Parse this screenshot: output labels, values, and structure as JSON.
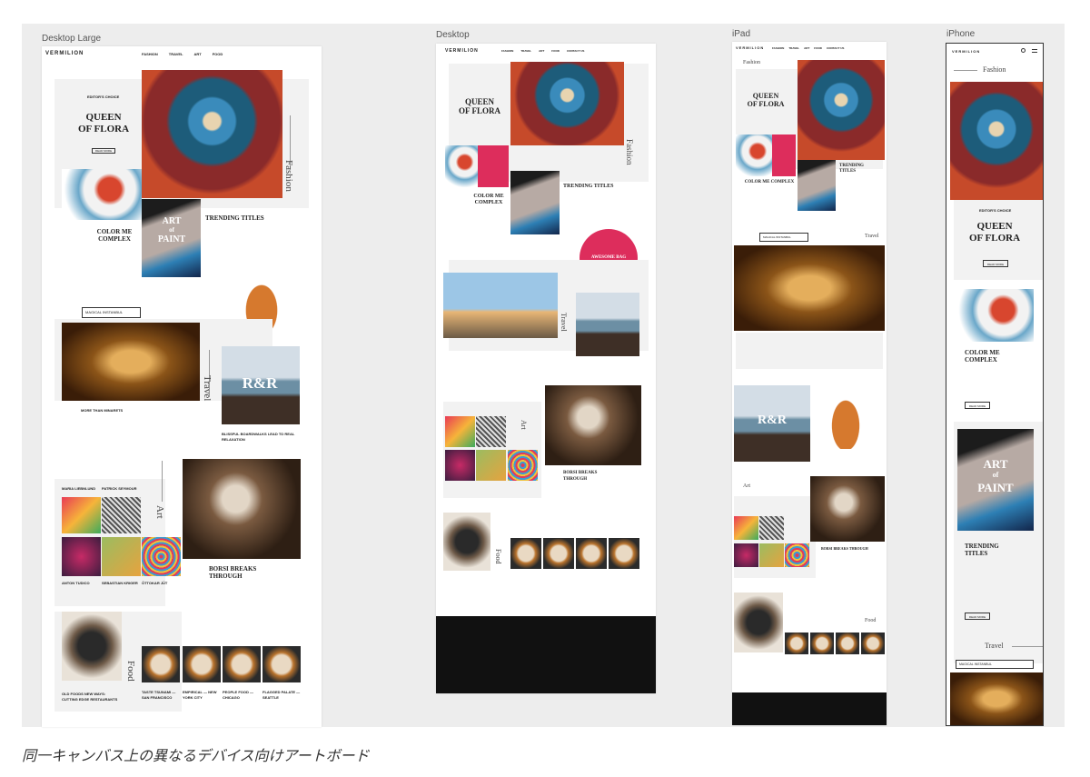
{
  "artboards": {
    "desktop_large": {
      "title": "Desktop Large",
      "logo": "VERMILION",
      "nav": [
        "FASHION",
        "TRAVEL",
        "ART",
        "FOOD"
      ],
      "editors_choice": "EDITOR'S CHOICE",
      "hero_title_1": "QUEEN",
      "hero_title_2": "OF FLORA",
      "read_more": "READ MORE",
      "fashion": "Fashion",
      "color_me_1": "COLOR ME",
      "color_me_2": "COMPLEX",
      "trending_1": "TRENDING TITLES",
      "art_of_paint_1": "ART",
      "art_of_paint_2": "of",
      "art_of_paint_3": "PAINT",
      "select": "MAGICAL INSTANBUL",
      "travel": "Travel",
      "more_than_minarets": "MORE THAN MINARETS",
      "rr": "R&R",
      "blissful": "BLISSFUL BOARDWALKS LEAD TO REAL RELAXATION",
      "art": "Art",
      "maria": "MARIA LIEBNLUND",
      "patrick": "PATRICK SEYMOUR",
      "anton": "ANTON TUDICO",
      "sebastian": "SEBASTIAN KRIGER",
      "ottokar": "ÖTTOKAR JÜT",
      "borsi_1": "BORSI BREAKS",
      "borsi_2": "THROUGH",
      "food": "Food",
      "old_foods": "OLD FOODS NEW WAYS: CUTTING EDGE RESTAURANTS",
      "taste_tsunami": "TASTE TSUNAMI — SAN FRANCISCO",
      "empirical": "EMPIRICAL — NEW YORK CITY",
      "people_food": "PEOPLE FOOD — CHICAGO",
      "flagged_palate": "FLAGGED PALATE — SEATTLE"
    },
    "desktop": {
      "title": "Desktop",
      "logo": "VERMILION",
      "nav": [
        "FASHION",
        "TRAVEL",
        "ART",
        "FOOD",
        "CONTACT US"
      ],
      "hero_title_1": "QUEEN",
      "hero_title_2": "OF FLORA",
      "fashion": "Fashion",
      "color_me_1": "COLOR ME",
      "color_me_2": "COMPLEX",
      "trending": "TRENDING TITLES",
      "awesome_bag": "AWESOME BAG",
      "travel": "Travel",
      "art": "Art",
      "borsi_1": "BORSI BREAKS",
      "borsi_2": "THROUGH",
      "food": "Food"
    },
    "ipad": {
      "title": "iPad",
      "logo": "VERMILION",
      "nav": [
        "FASHION",
        "TRAVEL",
        "ART",
        "FOOD",
        "CONTACT US"
      ],
      "fashion": "Fashion",
      "hero_title_1": "QUEEN",
      "hero_title_2": "OF FLORA",
      "color_me": "COLOR ME COMPLEX",
      "trending_1": "TRENDING",
      "trending_2": "TITLES",
      "select": "MAGICAL INSTANBUL",
      "travel": "Travel",
      "rr": "R&R",
      "art": "Art",
      "borsi": "BORSI BREAKS THROUGH",
      "food": "Food"
    },
    "iphone": {
      "title": "iPhone",
      "logo": "VERMILION",
      "fashion": "Fashion",
      "editors_choice": "EDITOR'S CHOICE",
      "hero_title_1": "QUEEN",
      "hero_title_2": "OF FLORA",
      "read_more": "READ MORE",
      "color_me_1": "COLOR ME",
      "color_me_2": "COMPLEX",
      "art_of_paint_1": "ART",
      "art_of_paint_2": "of",
      "art_of_paint_3": "PAINT",
      "trending_1": "TRENDING",
      "trending_2": "TITLES",
      "travel": "Travel",
      "select": "MAGICAL INSTANBUL"
    }
  },
  "caption": "同一キャンバス上の異なるデバイス向けアートボード"
}
